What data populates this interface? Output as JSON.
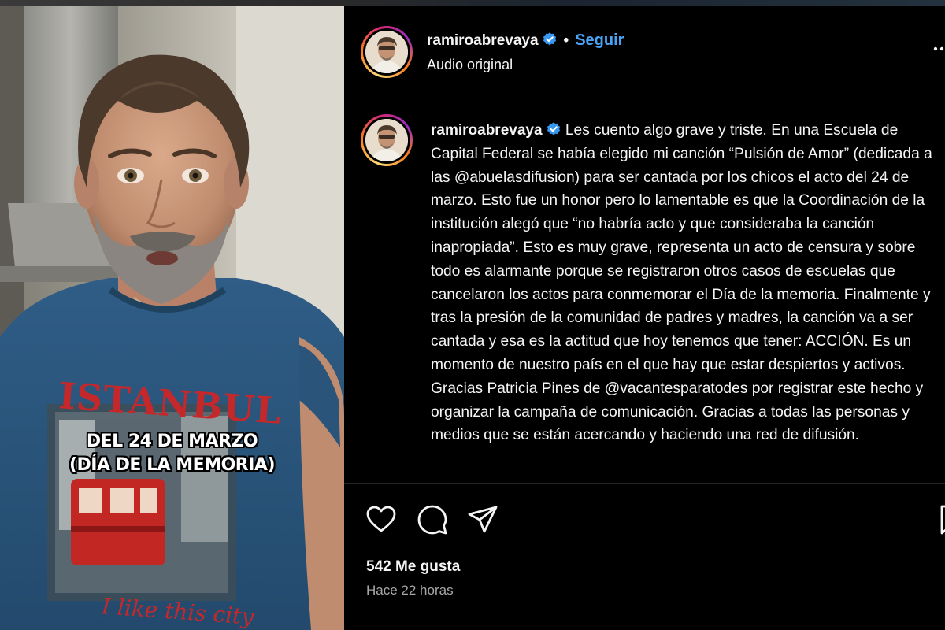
{
  "video": {
    "caption_line1": "DEL 24 DE MARZO",
    "caption_line2": "(DÍA DE LA MEMORIA)",
    "shirt_text_top": "ISTANBUL",
    "shirt_text_bottom": "I like this city"
  },
  "header": {
    "username": "ramiroabrevaya",
    "separator": "•",
    "follow_label": "Seguir",
    "subtitle": "Audio original"
  },
  "caption": {
    "username": "ramiroabrevaya",
    "text": "Les cuento algo grave y triste. En una Escuela de Capital Federal se había elegido mi canción “Pulsión de Amor” (dedicada a las @abuelasdifusion) para ser cantada por los chicos el acto del 24 de marzo. Esto fue un honor pero lo lamentable es que la Coordinación de la institución alegó que “no habría acto y que consideraba la canción inapropiada”. Esto es muy grave, representa un acto de censura y sobre todo es alarmante porque se registraron otros casos de escuelas que cancelaron los actos para conmemorar el Día de la memoria. Finalmente y tras la presión de la comunidad de padres y madres, la canción va a ser cantada y esa es la actitud que hoy tenemos que tener: ACCIÓN. Es un momento de nuestro país en el que hay que estar despiertos y activos. Gracias Patricia Pines de @vacantesparatodes por registrar este hecho y organizar la campaña de comunicación. Gracias a todas las personas y medios que se están acercando y haciendo una red de difusión."
  },
  "stats": {
    "likes": "542 Me gusta",
    "time": "Hace 22 horas"
  },
  "icons": {
    "more": "more-options-icon",
    "like": "heart-icon",
    "comment": "comment-icon",
    "share": "paper-plane-icon",
    "save": "bookmark-icon",
    "verified": "verified-badge-icon"
  },
  "colors": {
    "background": "#000000",
    "text": "#f5f5f5",
    "link": "#4aa3f5",
    "muted": "#a8a8a8",
    "verified": "#3897f0"
  }
}
